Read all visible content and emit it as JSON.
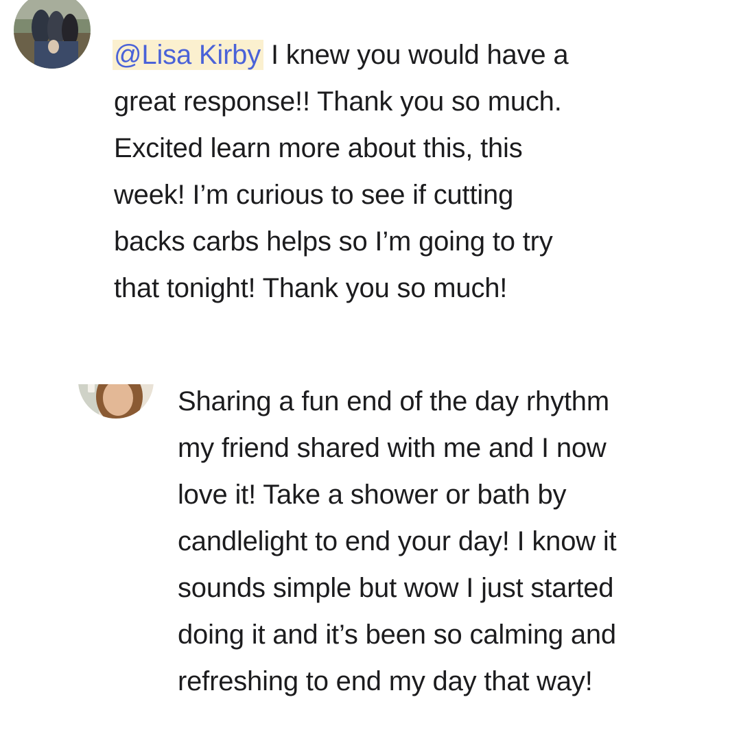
{
  "comments": [
    {
      "avatar_icon": "user-avatar-photo",
      "mention": "@Lisa Kirby",
      "lines": [
        " I knew you would have a",
        "great response!! Thank you so much.",
        "Excited learn more about this, this",
        "week! I’m curious to see if cutting",
        "backs carbs helps so I’m going to try",
        "that tonight! Thank you so much!"
      ]
    },
    {
      "avatar_icon": "user-avatar-photo",
      "lines": [
        "Sharing a fun end of the day rhythm",
        "my friend shared with me and I now",
        "love it! Take a shower or bath by",
        "candlelight to end your day! I know it",
        "sounds simple but wow I just started",
        "doing it and it’s been so calming and",
        "refreshing to end my day that way!"
      ]
    }
  ],
  "colors": {
    "text": "#1c1c1e",
    "mention_text": "#4a62d8",
    "mention_highlight": "#fbf0cf",
    "background": "#ffffff"
  }
}
